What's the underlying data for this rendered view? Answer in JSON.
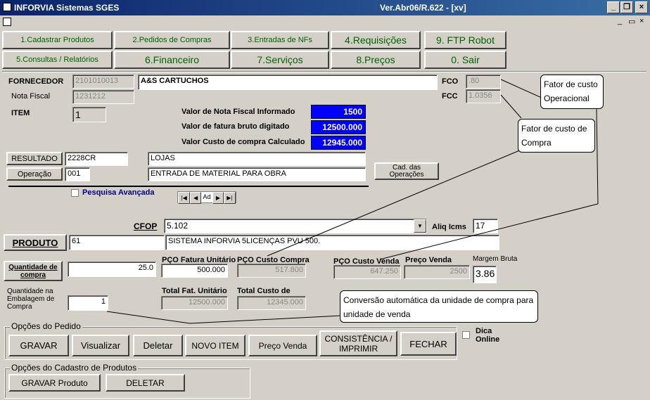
{
  "window": {
    "title": "INFORVIA Sistemas SGES",
    "version": "Ver.Abr06/R.622 - [xv]",
    "min_icon": "_",
    "max_icon": "❐",
    "close_icon": "×",
    "mdi_min": "_",
    "mdi_restore": "▭",
    "mdi_close": "×"
  },
  "nav": {
    "cadastrar": "1.Cadastrar Produtos",
    "pedidos": "2.Pedidos de Compras",
    "entradas": "3.Entradas de NFs",
    "requisicoes": "4.Requisições",
    "ftp": "9. FTP Robot",
    "consultas": "5.Consultas / Relatórios",
    "financeiro": "6.Financeiro",
    "servicos": "7.Serviços",
    "precos": "8.Preços",
    "sair": "0. Sair"
  },
  "form": {
    "fornecedor_label": "FORNECEDOR",
    "fornecedor_code": "2101010013",
    "fornecedor_name": "A&S CARTUCHOS",
    "nota_label": "Nota Fiscal",
    "nota_value": "1231212",
    "item_label": "ITEM",
    "item_value": "1",
    "fco_label": "FCO",
    "fco_value": ".80",
    "fcc_label": "FCC",
    "fcc_value": "1.0356",
    "valor_nf_label": "Valor de Nota Fiscal  Informado",
    "valor_nf_value": "1500",
    "valor_fatura_label": "Valor de fatura bruto digitado",
    "valor_fatura_value": "12500.000",
    "valor_custo_label": "Valor  Custo de compra Calculado",
    "valor_custo_value": "12945.000",
    "resultado_btn": "RESULTADO",
    "resultado_code": "2228CR",
    "resultado_desc": "LOJAS",
    "operacao_btn": "Operação",
    "operacao_code": "001",
    "operacao_desc": "ENTRADA DE MATERIAL PARA OBRA",
    "cad_operacoes_btn": "Cad. das Operações",
    "pesquisa_label": "Pesquisa Avançada",
    "nav_first": "|◀",
    "nav_prev": "◀",
    "nav_ad": "Ad",
    "nav_next": "▶",
    "nav_last": "▶|",
    "cfop_label": "CFOP",
    "cfop_value": "5.102",
    "aliq_label": "Aliq Icms",
    "aliq_value": "17",
    "produto_btn": "PRODUTO",
    "produto_code": "61",
    "produto_desc": "SISTEMA INFORVIA  5LICENÇAS        PVU 500.",
    "quantidade_btn": "Quantidade de compra",
    "quantidade_value": "25.0",
    "pco_fatura_label": "PÇO Fatura Unitário",
    "pco_fatura_value": "500.000",
    "pco_custo_label": "PÇO Custo Compra",
    "pco_custo_value": "517.800",
    "pco_venda_label": "PÇO Custo Venda",
    "pco_venda_value": "647.250",
    "preco_venda_label": "Preço Venda",
    "preco_venda_value": "2500",
    "margem_label": "Margem Bruta",
    "margem_value": "3.86",
    "qtd_emb_label": "Quantidade na Embalagem de Compra",
    "qtd_emb_value": "1",
    "total_fat_label": "Total Fat. Unitário",
    "total_fat_value": "12500.000",
    "total_custo_label": "Total Custo de",
    "total_custo_value": "12345.000"
  },
  "notes": {
    "fco": "Fator de custo Operacional",
    "fcc": "Fator de custo de Compra",
    "conversao": "Conversão automática da unidade de compra para unidade de venda"
  },
  "pedido": {
    "group_label": "Opções do Pedido",
    "gravar": "GRAVAR",
    "visualizar": "Visualizar",
    "deletar": "Deletar",
    "novo_item": "NOVO ITEM",
    "preco_venda": "Preço Venda",
    "consistencia": "CONSISTÊNCIA / IMPRIMIR",
    "fechar": "FECHAR",
    "dica": "Dica Online"
  },
  "cadastro": {
    "group_label": "Opções do Cadastro de Produtos",
    "gravar": "GRAVAR Produto",
    "deletar": "DELETAR"
  }
}
